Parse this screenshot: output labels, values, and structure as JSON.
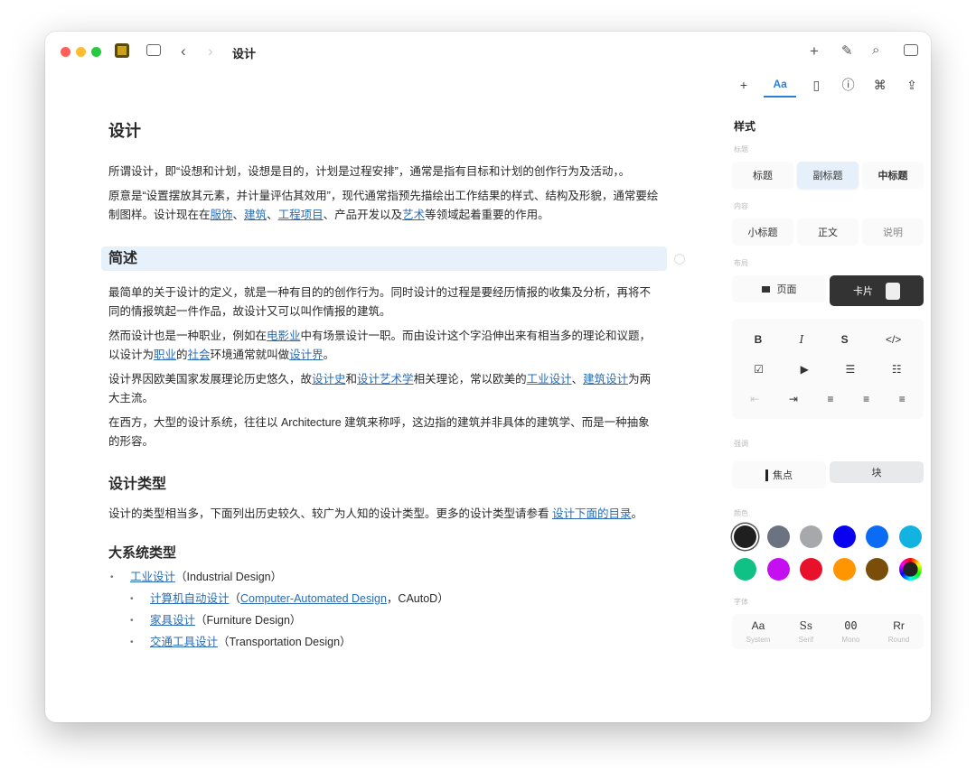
{
  "window": {
    "title": "设计"
  },
  "doc": {
    "title": "设计",
    "intro": [
      [
        {
          "t": "所谓设计，即“设想和计划，设想是目的，计划是过程安排”，通常是指有目标和计划的创作行为及活动，。"
        }
      ],
      [
        {
          "t": "原意是“设置摆放其元素，并计量评估其效用”，现代通常指预先描绘出工作结果的样式、结构及形貌，通常要绘制图样。设计现在在"
        },
        {
          "t": "服饰",
          "link": true
        },
        {
          "t": "、"
        },
        {
          "t": "建筑",
          "link": true
        },
        {
          "t": "、"
        },
        {
          "t": "工程项目",
          "link": true
        },
        {
          "t": "、产品开发以及"
        },
        {
          "t": "艺术",
          "link": true
        },
        {
          "t": "等领域起着重要的作用。"
        }
      ]
    ],
    "section1": "简述",
    "section1_paras": [
      [
        {
          "t": "最简单的关于设计的定义，就是一种有目的的创作行为。同时设计的过程是要经历情报的收集及分析，再将不同的情报筑起一件作品，故设计又可以叫作情报的建筑。"
        }
      ],
      [
        {
          "t": "然而设计也是一种职业，例如在"
        },
        {
          "t": "电影业",
          "link": true
        },
        {
          "t": "中有场景设计一职。而由设计这个字沿伸出来有相当多的理论和议题，以设计为"
        },
        {
          "t": "职业",
          "link": true
        },
        {
          "t": "的"
        },
        {
          "t": "社会",
          "link": true
        },
        {
          "t": "环境通常就叫做"
        },
        {
          "t": "设计界",
          "link": true
        },
        {
          "t": "。"
        }
      ],
      [
        {
          "t": "设计界因欧美国家发展理论历史悠久，故"
        },
        {
          "t": "设计史",
          "link": true
        },
        {
          "t": "和"
        },
        {
          "t": "设计艺术学",
          "link": true
        },
        {
          "t": "相关理论，常以欧美的"
        },
        {
          "t": "工业设计",
          "link": true
        },
        {
          "t": "、"
        },
        {
          "t": "建筑设计",
          "link": true
        },
        {
          "t": "为两大主流。"
        }
      ],
      [
        {
          "t": "在西方，大型的设计系统，往往以 Architecture 建筑来称呼，这边指的建筑并非具体的建筑学、而是一种抽象的形容。"
        }
      ]
    ],
    "section2": "设计类型",
    "section2_paras": [
      [
        {
          "t": "设计的类型相当多，下面列出历史较久、较广为人知的设计类型。更多的设计类型请参看 "
        },
        {
          "t": "设计下面的目录",
          "link": true
        },
        {
          "t": "。"
        }
      ]
    ],
    "section3": "大系统类型",
    "list": [
      {
        "level": 1,
        "parts": [
          {
            "t": "工业设计",
            "link": true
          },
          {
            "t": "（Industrial Design）"
          }
        ]
      },
      {
        "level": 2,
        "parts": [
          {
            "t": "计算机自动设计",
            "link": true
          },
          {
            "t": "（"
          },
          {
            "t": "Computer-Automated Design",
            "link": true
          },
          {
            "t": "，CAutoD）"
          }
        ]
      },
      {
        "level": 2,
        "parts": [
          {
            "t": "家具设计",
            "link": true
          },
          {
            "t": "（Furniture Design）"
          }
        ]
      },
      {
        "level": 2,
        "parts": [
          {
            "t": "交通工具设计",
            "link": true
          },
          {
            "t": "（Transportation Design）"
          }
        ]
      }
    ]
  },
  "panel": {
    "heading": "样式",
    "label_heading": "标题",
    "headings": [
      "标题",
      "副标题",
      "中标题"
    ],
    "label_content": "内容",
    "content": [
      "小标题",
      "正文",
      "说明"
    ],
    "label_layout": "布局",
    "layout": [
      "页面",
      "卡片"
    ],
    "format_row1": [
      "B",
      "I",
      "S",
      "</>"
    ],
    "label_emphasis": "强调",
    "emphasis": [
      "焦点",
      "块"
    ],
    "label_color": "颜色",
    "colors": [
      "#1f1f1f",
      "#6b7380",
      "#a6a8ab",
      "#0a00f0",
      "#0a6cf5",
      "#12b3e0",
      "#10c186",
      "#c40ff0",
      "#e8102a",
      "#ff9500",
      "#7a4d0a"
    ],
    "label_font": "字体",
    "fonts": [
      {
        "s": "Aa",
        "n": "System"
      },
      {
        "s": "Ss",
        "n": "Serif"
      },
      {
        "s": "00",
        "n": "Mono"
      },
      {
        "s": "Rr",
        "n": "Round"
      }
    ]
  }
}
